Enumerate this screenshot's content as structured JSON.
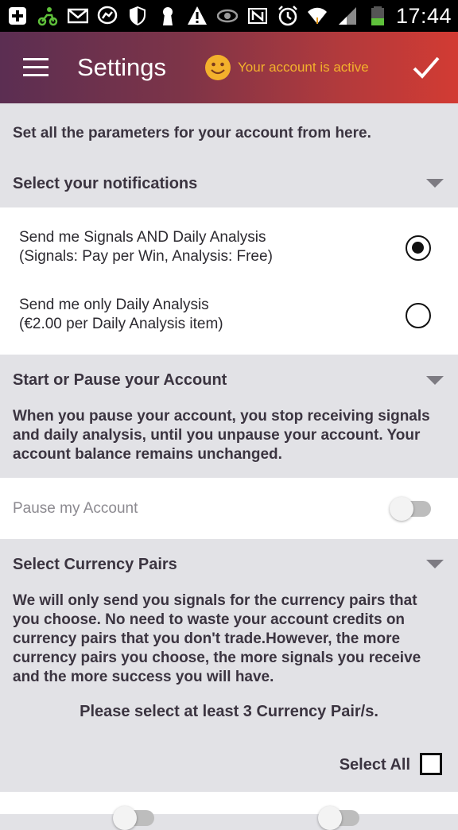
{
  "status_bar": {
    "icons": [
      "plus-box-icon",
      "scooter-icon",
      "mail-icon",
      "messenger-icon",
      "shield-icon",
      "keyhole-icon",
      "warning-icon",
      "eye-icon",
      "nfc-icon",
      "alarm-icon",
      "wifi-icon",
      "signal-icon",
      "battery-icon"
    ],
    "time": "17:44"
  },
  "app_bar": {
    "title": "Settings",
    "account_status": "Your account is active",
    "accent_color": "#f3b12c"
  },
  "intro_text": "Set all the parameters for your account from here.",
  "notifications": {
    "header": "Select your notifications",
    "options": [
      {
        "line1": "Send me Signals AND Daily Analysis",
        "line2": "(Signals: Pay per Win, Analysis: Free)",
        "selected": true
      },
      {
        "line1": "Send me only Daily Analysis",
        "line2": "(€2.00 per Daily Analysis item)",
        "selected": false
      }
    ]
  },
  "account": {
    "header": "Start or Pause your Account",
    "description": [
      "When you pause your account, you stop receiving signals",
      "and daily analysis, until you unpause your account. Your",
      "account balance remains unchanged."
    ],
    "pause_label": "Pause my Account",
    "paused": false
  },
  "currency": {
    "header": "Select Currency Pairs",
    "description": [
      "We will only send you signals for the currency pairs that",
      "you choose. No need to waste your account credits on",
      "currency pairs that you don't trade.However, the more",
      "currency pairs you choose, the more signals you receive",
      "and the more success you will have."
    ],
    "minimum_note": "Please select at least 3 Currency Pair/s.",
    "select_all_label": "Select All",
    "select_all_checked": false
  }
}
